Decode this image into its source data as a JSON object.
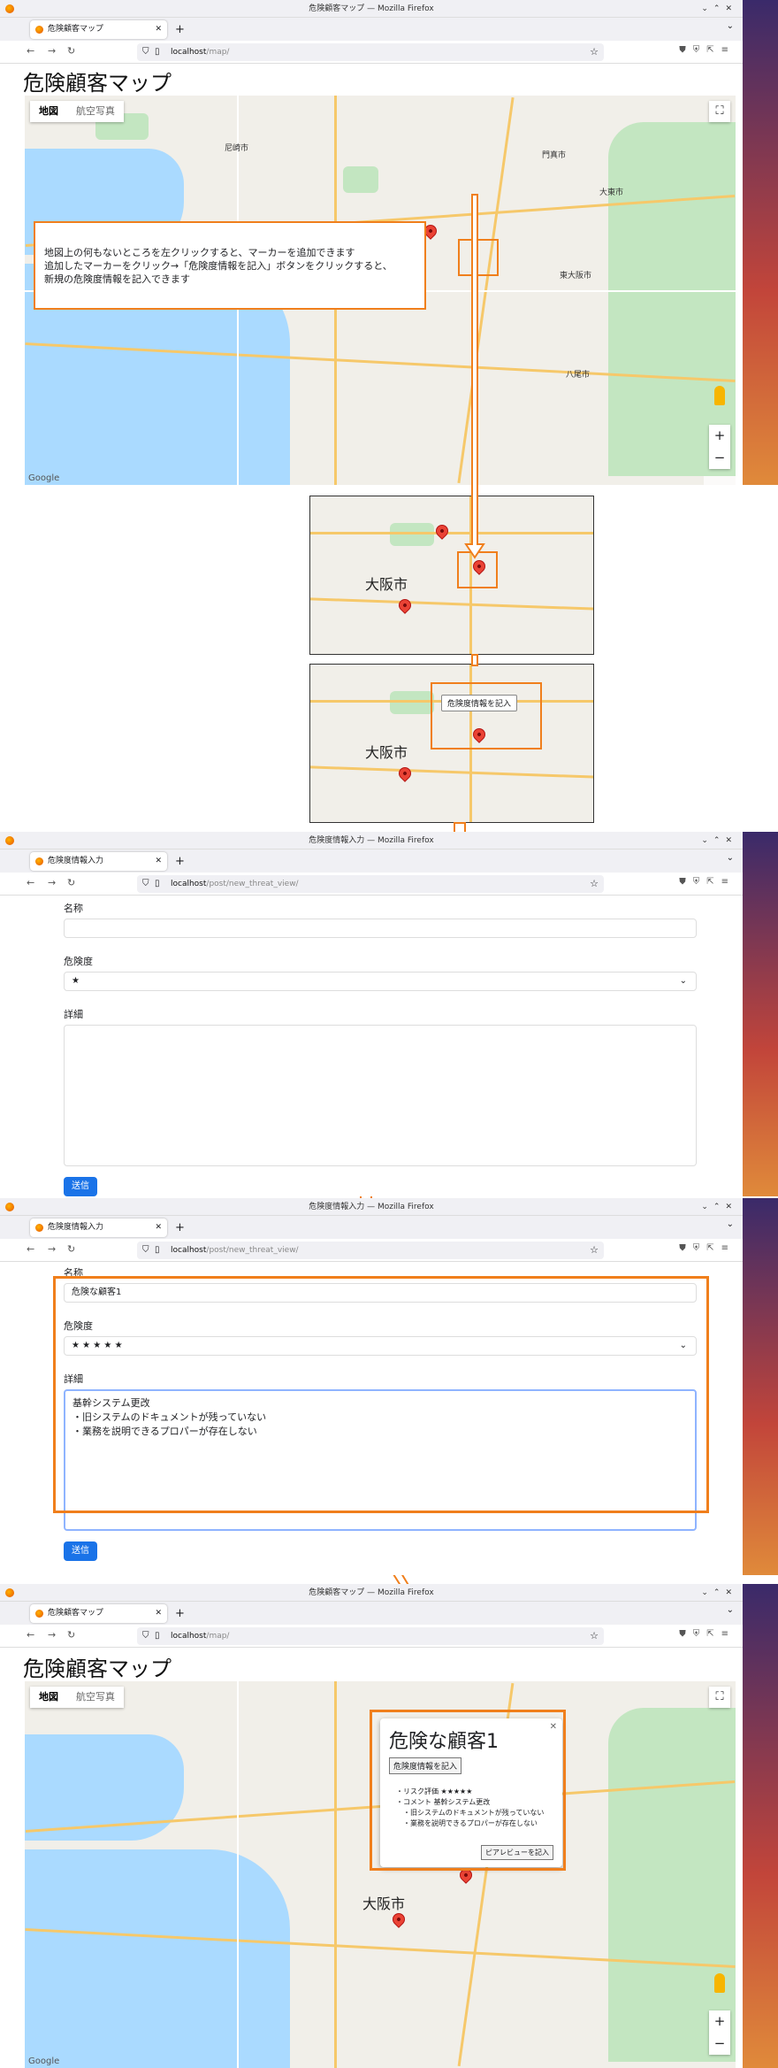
{
  "colors": {
    "accent": "#f07f1c",
    "pin": "#ea4335",
    "submit": "#1a73e8"
  },
  "screen1": {
    "window_title": "危険顧客マップ — Mozilla Firefox",
    "tab_title": "危険顧客マップ",
    "url_host": "localhost",
    "url_path": "/map/",
    "page_title": "危険顧客マップ",
    "map_type": {
      "map": "地図",
      "satellite": "航空写真"
    },
    "note_lines": [
      "地図上の何もないところを左クリックすると、マーカーを追加できます",
      "追加したマーカーをクリック→「危険度情報を記入」ボタンをクリックすると、",
      "新規の危険度情報を記入できます"
    ],
    "labels": [
      "尼崎市",
      "門真市",
      "大東市",
      "東大阪市",
      "八尾市"
    ],
    "google": "Google"
  },
  "inset": {
    "city_label": "大阪市",
    "popup_button": "危険度情報を記入"
  },
  "screen2": {
    "window_title": "危険度情報入力 — Mozilla Firefox",
    "tab_title": "危険度情報入力",
    "url_host": "localhost",
    "url_path": "/post/new_threat_view/",
    "name_label": "名称",
    "level_label": "危険度",
    "level_value": "★",
    "detail_label": "詳細",
    "submit": "送信"
  },
  "screen3": {
    "window_title": "危険度情報入力 — Mozilla Firefox",
    "tab_title": "危険度情報入力",
    "url_host": "localhost",
    "url_path": "/post/new_threat_view/",
    "name_label": "名称",
    "name_value": "危険な顧客1",
    "level_label": "危険度",
    "level_value": "★ ★ ★ ★ ★",
    "detail_label": "詳細",
    "detail_lines": [
      "基幹システム更改",
      "・旧システムのドキュメントが残っていない",
      "・業務を説明できるプロパーが存在しない"
    ],
    "submit": "送信"
  },
  "screen4": {
    "window_title": "危険顧客マップ — Mozilla Firefox",
    "tab_title": "危険顧客マップ",
    "url_host": "localhost",
    "url_path": "/map/",
    "page_title": "危険顧客マップ",
    "map_type": {
      "map": "地図",
      "satellite": "航空写真"
    },
    "city_label": "大阪市",
    "info_window": {
      "title": "危険な顧客1",
      "button": "危険度情報を記入",
      "risk": "・リスク評価 ★★★★★",
      "comment": "・コメント 基幹システム更改",
      "line1": "・旧システムのドキュメントが残っていない",
      "line2": "・業務を説明できるプロパーが存在しない",
      "peer_button": "ピアレビューを記入"
    },
    "google": "Google"
  }
}
